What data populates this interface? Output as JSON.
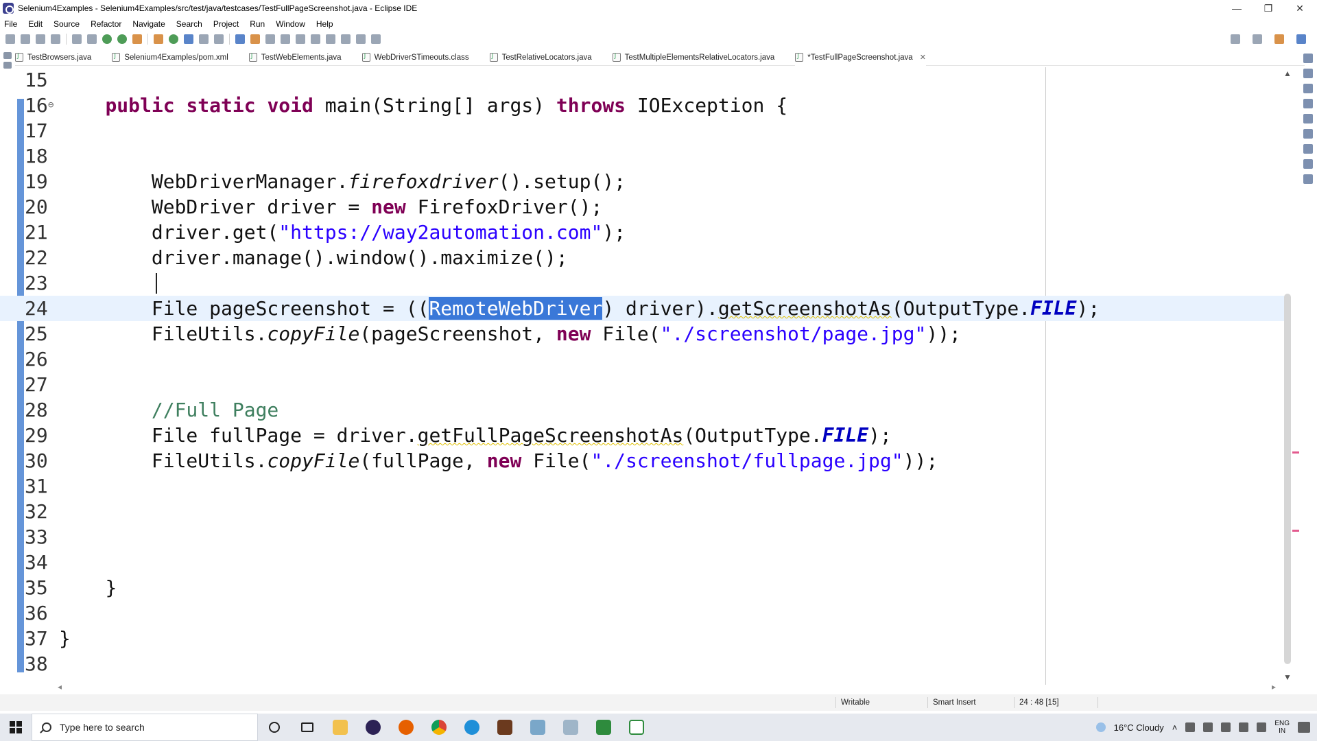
{
  "window": {
    "title": "Selenium4Examples - Selenium4Examples/src/test/java/testcases/TestFullPageScreenshot.java - Eclipse IDE"
  },
  "menu": [
    "File",
    "Edit",
    "Source",
    "Refactor",
    "Navigate",
    "Search",
    "Project",
    "Run",
    "Window",
    "Help"
  ],
  "tabs": [
    {
      "label": "TestBrowsers.java"
    },
    {
      "label": "Selenium4Examples/pom.xml"
    },
    {
      "label": "TestWebElements.java"
    },
    {
      "label": "WebDriverSTimeouts.class"
    },
    {
      "label": "TestRelativeLocators.java"
    },
    {
      "label": "TestMultipleElementsRelativeLocators.java"
    },
    {
      "label": "*TestFullPageScreenshot.java",
      "active": true,
      "close": "✕"
    }
  ],
  "editor": {
    "line_numbers": [
      "15",
      "16",
      "17",
      "18",
      "19",
      "20",
      "21",
      "22",
      "23",
      "24",
      "25",
      "26",
      "27",
      "28",
      "29",
      "30",
      "31",
      "32",
      "33",
      "34",
      "35",
      "36",
      "37",
      "38"
    ],
    "code": {
      "l16": {
        "kw1": "public static void",
        "t1": " main(String[] args) ",
        "kw2": "throws",
        "t2": " IOException {"
      },
      "l19": {
        "t1": "WebDriverManager.",
        "i1": "firefoxdriver",
        "t2": "().setup();"
      },
      "l20": {
        "t1": "WebDriver driver = ",
        "kw1": "new",
        "t2": " FirefoxDriver();"
      },
      "l21": {
        "t1": "driver.get(",
        "s1": "\"https://way2automation.com\"",
        "t2": ");"
      },
      "l22": {
        "t1": "driver.manage().window().maximize();"
      },
      "l24": {
        "t1": "File pageScreenshot = ((",
        "sel": "RemoteWebDriver",
        "t2": ") driver).",
        "w1": "getScreenshotAs",
        "t3": "(OutputType.",
        "f1": "FILE",
        "t4": ");"
      },
      "l25": {
        "t1": "FileUtils.",
        "i1": "copyFile",
        "t2": "(pageScreenshot, ",
        "kw1": "new",
        "t3": " File(",
        "s1": "\"./screenshot/page.jpg\"",
        "t4": "));"
      },
      "l28": {
        "c1": "//Full Page"
      },
      "l29": {
        "t1": "File fullPage = driver.",
        "w1": "getFullPageScreenshotAs",
        "t2": "(OutputType.",
        "f1": "FILE",
        "t3": ");"
      },
      "l30": {
        "t1": "FileUtils.",
        "i1": "copyFile",
        "t2": "(fullPage, ",
        "kw1": "new",
        "t3": " File(",
        "s1": "\"./screenshot/fullpage.jpg\"",
        "t4": "));"
      },
      "l35": {
        "t1": "}"
      },
      "l37": {
        "t1": "}"
      }
    }
  },
  "status": {
    "writable": "Writable",
    "insert_mode": "Smart Insert",
    "position": "24 : 48 [15]"
  },
  "taskbar": {
    "search_placeholder": "Type here to search",
    "weather": "16°C  Cloudy",
    "lang_top": "ENG",
    "lang_bottom": "IN"
  },
  "colors": {
    "keyword": "#7f0055",
    "string": "#2a00ff",
    "comment": "#3f7f5f",
    "static_final": "#0000c0",
    "selection": "#3a78d8",
    "current_line": "#e8f2fe"
  }
}
